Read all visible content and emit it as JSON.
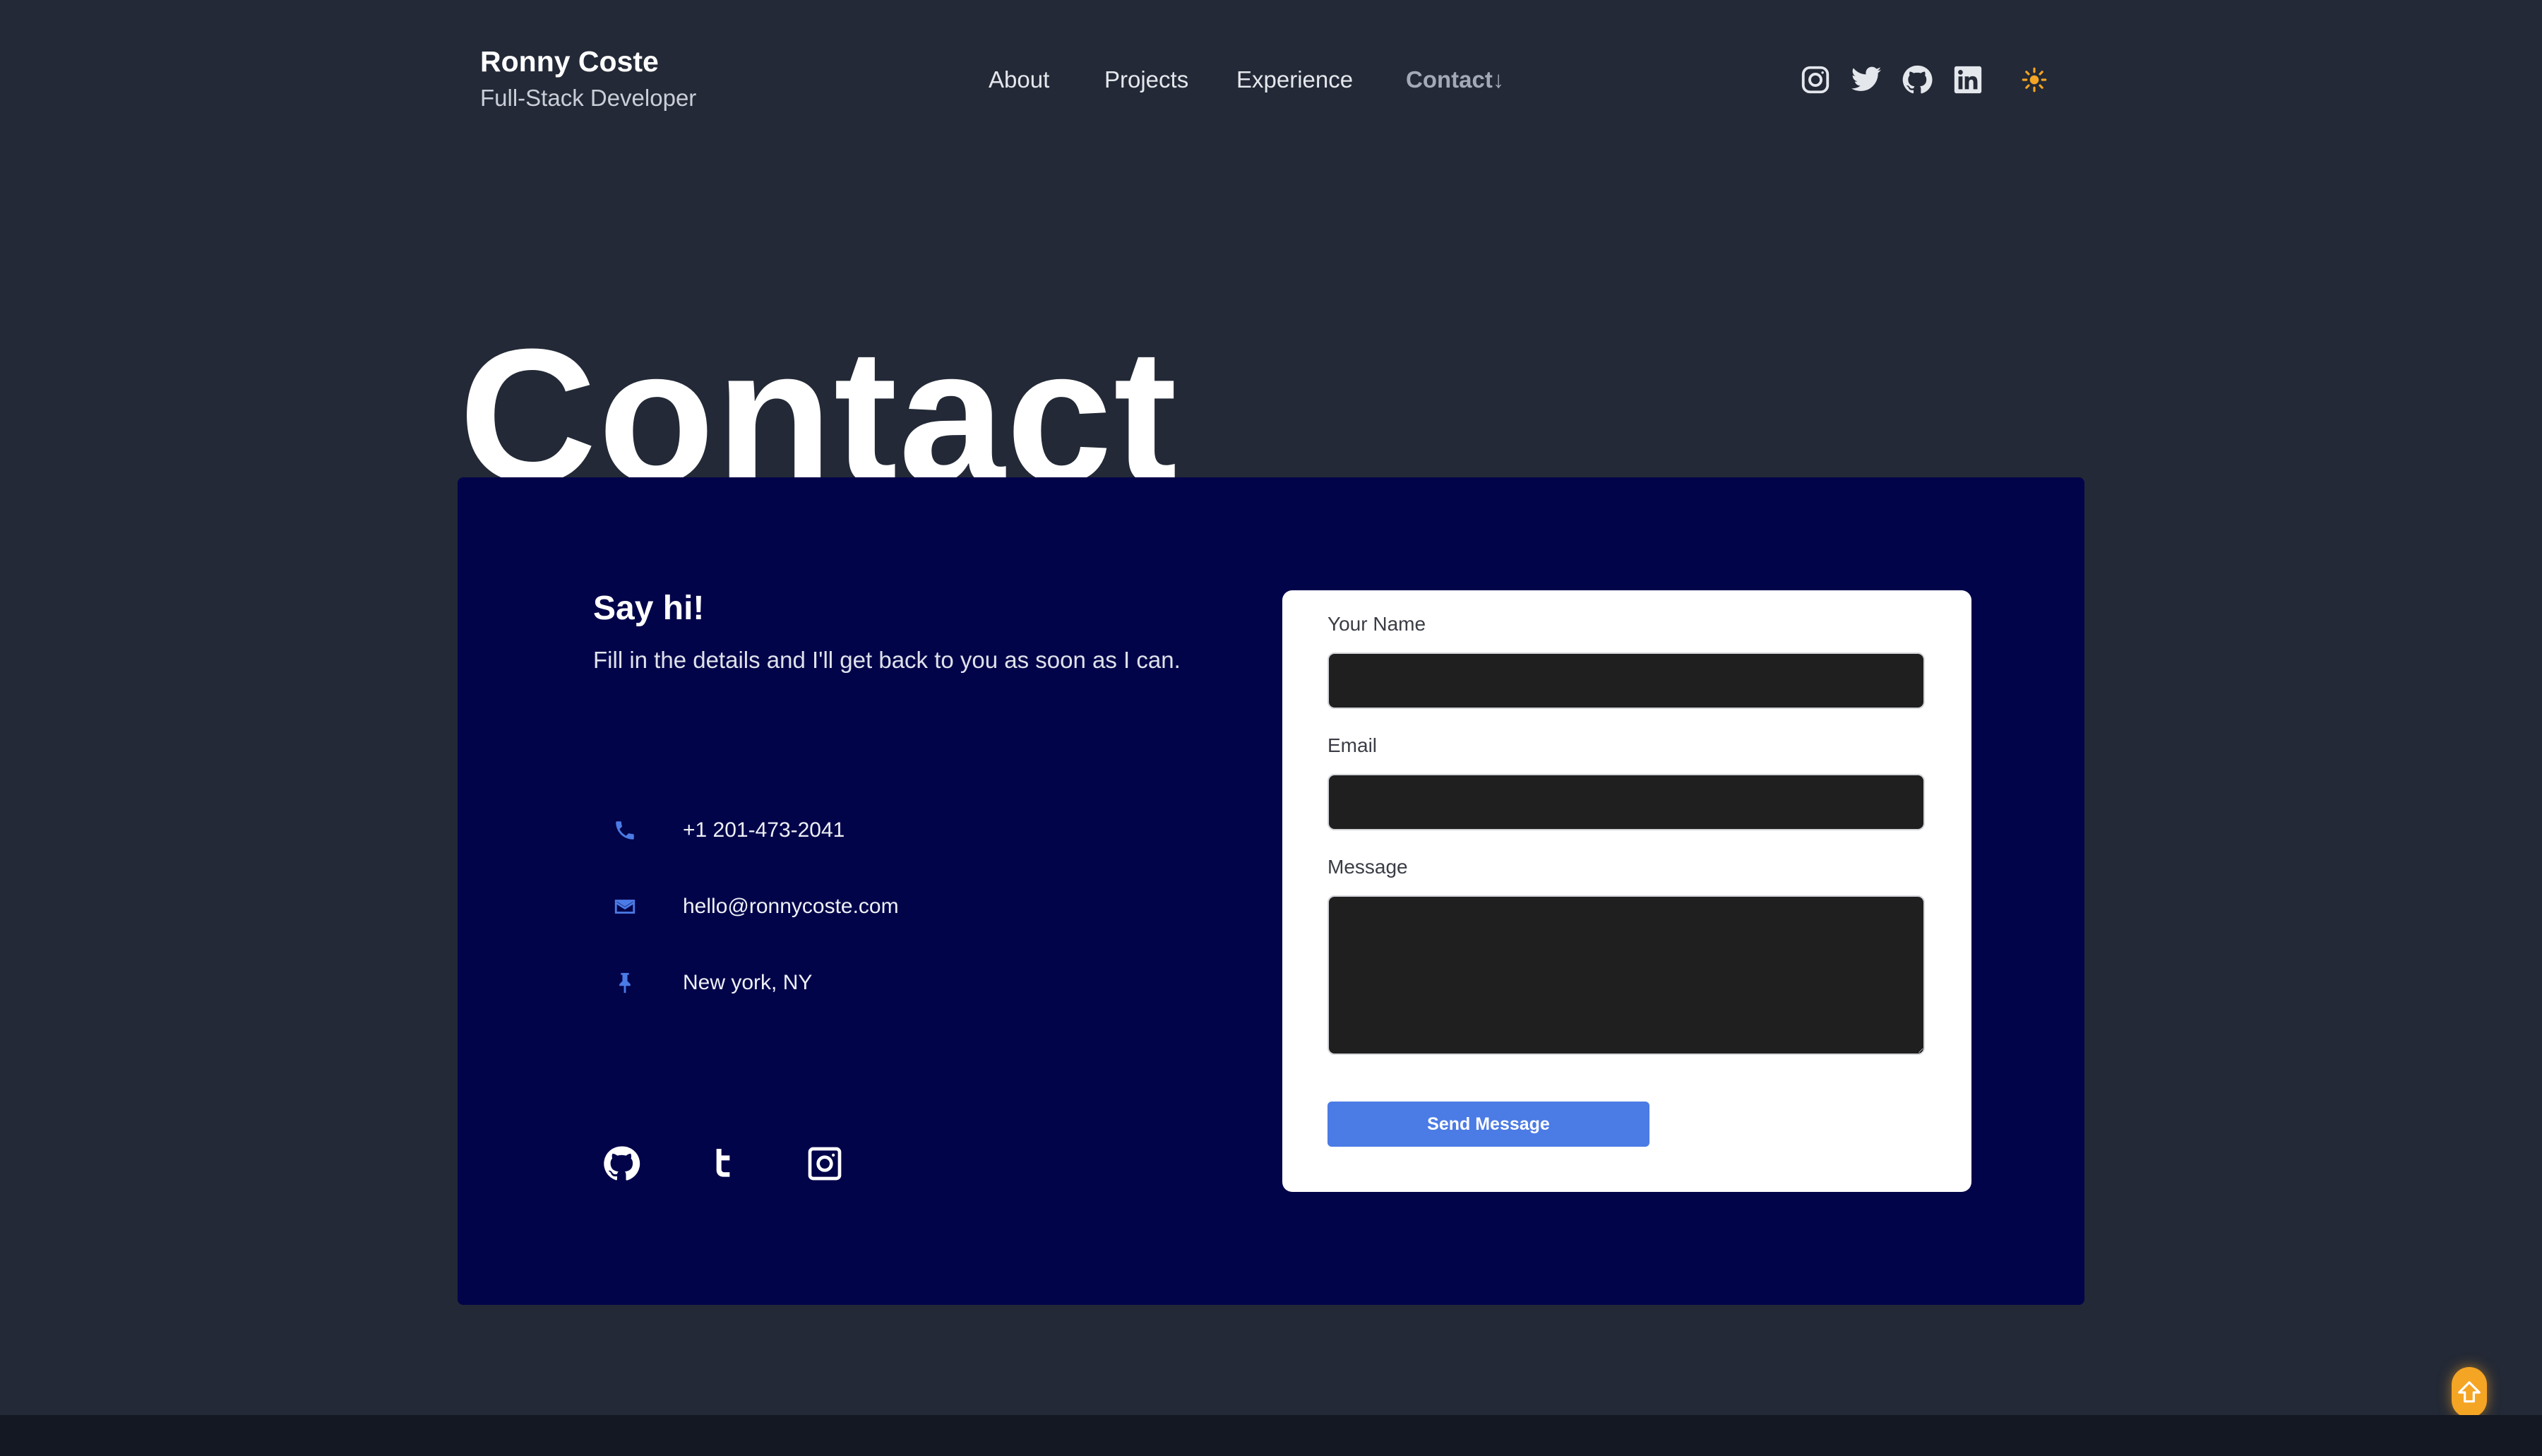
{
  "header": {
    "name": "Ronny Coste",
    "role": "Full-Stack Developer",
    "nav": [
      {
        "label": "About"
      },
      {
        "label": "Projects"
      },
      {
        "label": "Experience"
      },
      {
        "label": "Contact↓",
        "active": true
      }
    ],
    "social_icons": [
      "instagram-icon",
      "twitter-icon",
      "github-icon",
      "linkedin-icon"
    ],
    "theme_icon": "sun-icon"
  },
  "hero": {
    "title": "Contact"
  },
  "contact": {
    "heading": "Say hi!",
    "subtitle": "Fill in the details and I'll get back to you as soon as I can.",
    "info": [
      {
        "icon": "phone-icon",
        "text": "+1 201-473-2041"
      },
      {
        "icon": "mail-icon",
        "text": "hello@ronnycoste.com"
      },
      {
        "icon": "pin-icon",
        "text": "New york, NY"
      }
    ],
    "social_icons": [
      "github-icon",
      "tumblr-icon",
      "instagram-icon"
    ],
    "form": {
      "name_label": "Your Name",
      "name_value": "",
      "email_label": "Email",
      "email_value": "",
      "message_label": "Message",
      "message_value": "",
      "submit_label": "Send Message"
    }
  },
  "colors": {
    "page_bg": "#232936",
    "panel_bg": "#02044a",
    "accent": "#4b7be5",
    "scroll_top": "#f5a524"
  },
  "scroll_top_icon": "arrow-up-icon"
}
